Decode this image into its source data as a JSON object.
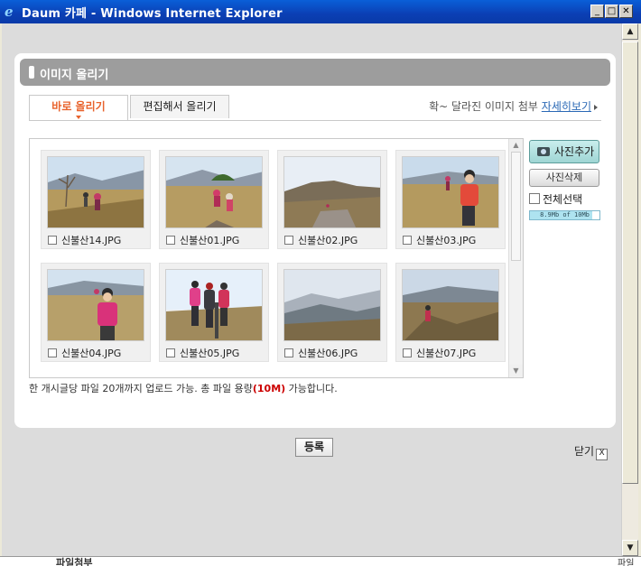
{
  "window": {
    "title": "Daum 카페 - Windows Internet Explorer",
    "icon": "ie-icon",
    "controls": [
      "_",
      "□",
      "✕"
    ]
  },
  "panel": {
    "header": "이미지 올리기",
    "tabs": [
      {
        "label": "바로 올리기",
        "active": true
      },
      {
        "label": "편집해서 올리기",
        "active": false
      }
    ],
    "note": "확~ 달라진 이미지 첨부",
    "note_link": "자세히보기"
  },
  "gallery": {
    "items": [
      {
        "name": "신불산14.JPG",
        "checked": false
      },
      {
        "name": "신불산01.JPG",
        "checked": false
      },
      {
        "name": "신불산02.JPG",
        "checked": false
      },
      {
        "name": "신불산03.JPG",
        "checked": false
      },
      {
        "name": "신불산04.JPG",
        "checked": false
      },
      {
        "name": "신불산05.JPG",
        "checked": false
      },
      {
        "name": "신불산06.JPG",
        "checked": false
      },
      {
        "name": "신불산07.JPG",
        "checked": false
      }
    ]
  },
  "side": {
    "add_label": "사진추가",
    "delete_label": "사진삭제",
    "select_all_label": "전체선택",
    "usage_text": "8.9Mb of 10Mb",
    "usage_fraction": 0.89
  },
  "info": {
    "prefix": "한 개시글당 파일 20개까지 업로드 가능. 총 파일 용량",
    "limit": "(10M)",
    "suffix": " 가능합니다."
  },
  "footer": {
    "submit_label": "등록",
    "close_label": "닫기",
    "close_x": "X"
  },
  "bottom": {
    "left_text": "파일첨부",
    "right_text": "파일"
  },
  "colors": {
    "accent": "#e8632d",
    "header": "#9d9d9d",
    "link": "#2a68b5",
    "limit": "#cc0000"
  }
}
